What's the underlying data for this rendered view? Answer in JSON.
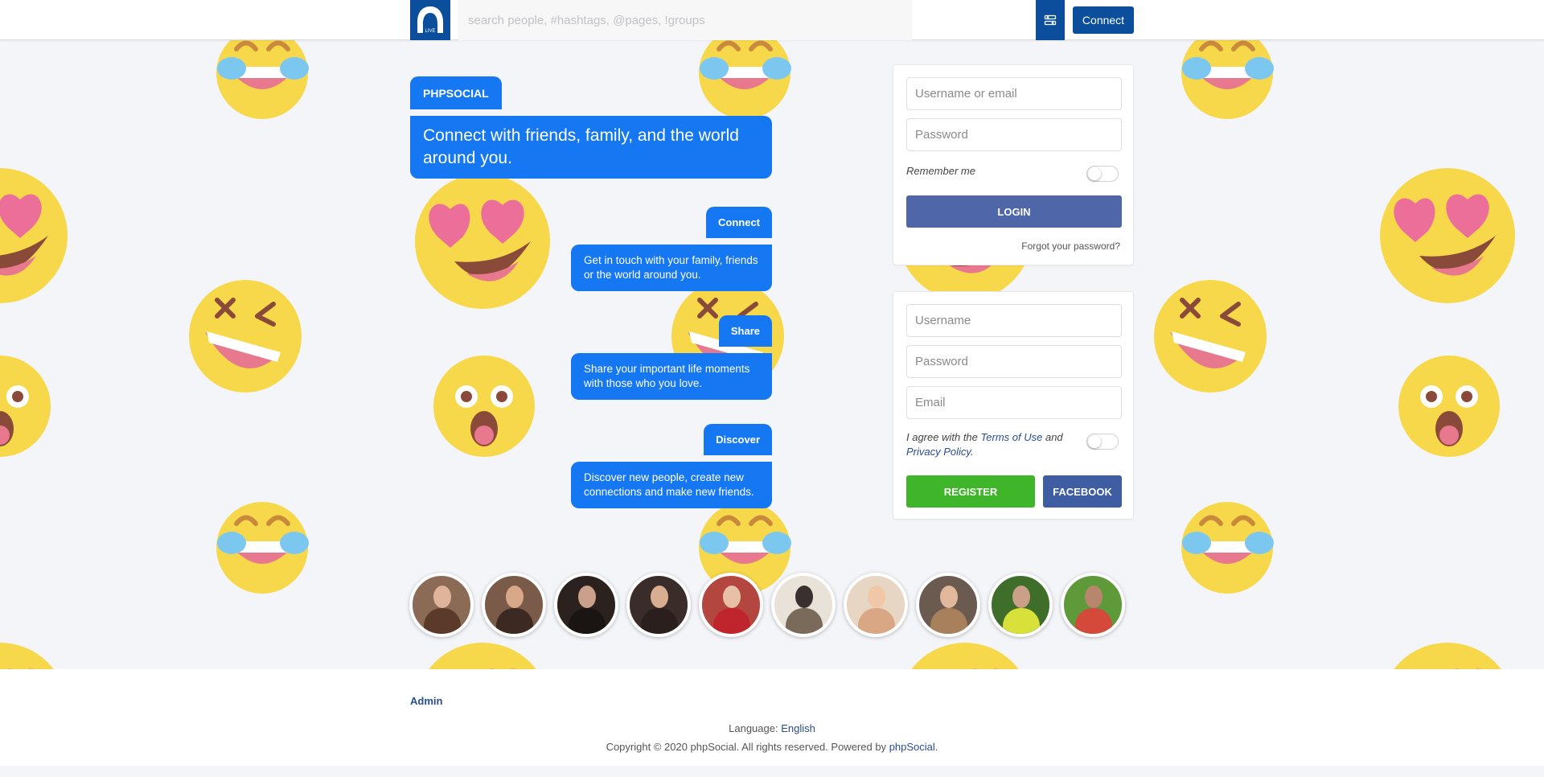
{
  "header": {
    "search_placeholder": "search people, #hashtags, @pages, !groups",
    "connect_label": "Connect",
    "logo_caption": "LIVE"
  },
  "chat": {
    "badge": "PHPSOCIAL",
    "headline": "Connect with friends, family, and the world around you.",
    "features": [
      {
        "tag": "Connect",
        "text": "Get in touch with your family, friends or the world around you."
      },
      {
        "tag": "Share",
        "text": "Share your important life moments with those who you love."
      },
      {
        "tag": "Discover",
        "text": "Discover new people, create new connections and make new friends."
      }
    ]
  },
  "login": {
    "username_placeholder": "Username or email",
    "password_placeholder": "Password",
    "remember_label": "Remember me",
    "login_label": "LOGIN",
    "forgot_label": "Forgot your password?"
  },
  "register": {
    "username_placeholder": "Username",
    "password_placeholder": "Password",
    "email_placeholder": "Email",
    "agree_prefix": "I agree with the",
    "terms_label": "Terms of Use",
    "agree_and": "and",
    "privacy_label": "Privacy Policy",
    "agree_suffix": ".",
    "register_label": "REGISTER",
    "facebook_label": "FACEBOOK"
  },
  "footer": {
    "admin_label": "Admin",
    "language_prefix": "Language:",
    "language_value": "English",
    "copyright": "Copyright © 2020 phpSocial. All rights reserved. Powered by",
    "powered_link": "phpSocial",
    "copyright_suffix": "."
  },
  "colors": {
    "brand": "#0b4f9c",
    "chat_blue": "#1677f2",
    "login_button": "#4f66a8",
    "register_button": "#3fb62a",
    "facebook_button": "#3e5da3"
  }
}
